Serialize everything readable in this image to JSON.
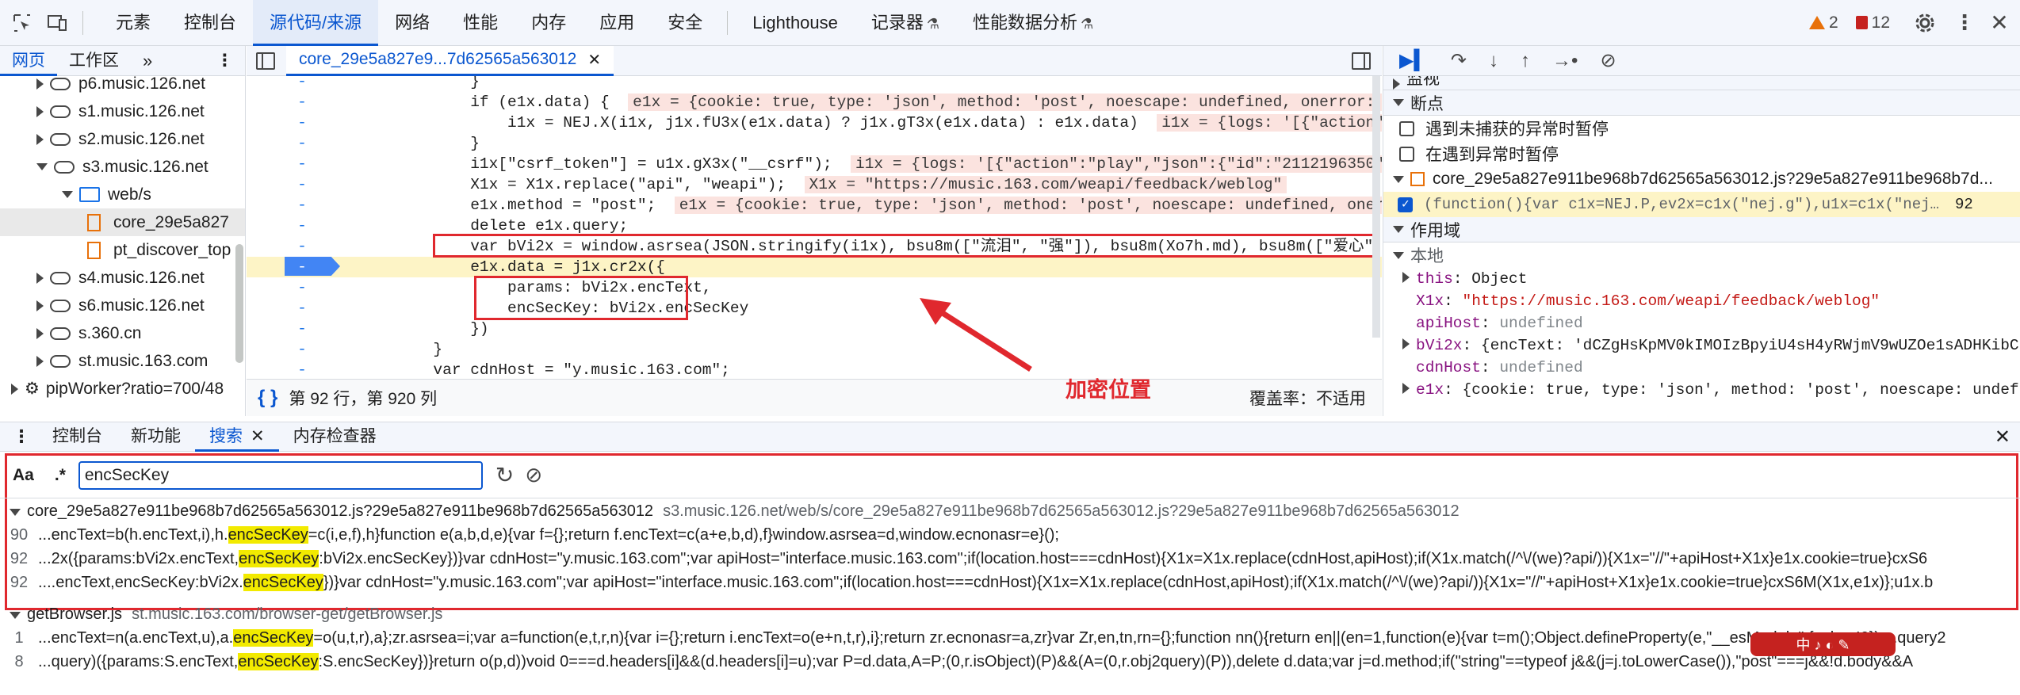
{
  "topbar": {
    "tabs": [
      "元素",
      "控制台",
      "源代码/来源",
      "网络",
      "性能",
      "内存",
      "应用",
      "安全",
      "Lighthouse",
      "记录器",
      "性能数据分析"
    ],
    "active_tab": "源代码/来源",
    "warnings": "2",
    "errors": "12"
  },
  "navigator": {
    "tabs": [
      "网页",
      "工作区"
    ],
    "items": [
      {
        "label": "p6.music.126.net",
        "depth": 1,
        "kind": "domain",
        "state": "collapsed"
      },
      {
        "label": "s1.music.126.net",
        "depth": 1,
        "kind": "domain",
        "state": "collapsed"
      },
      {
        "label": "s2.music.126.net",
        "depth": 1,
        "kind": "domain",
        "state": "collapsed"
      },
      {
        "label": "s3.music.126.net",
        "depth": 1,
        "kind": "domain",
        "state": "expanded"
      },
      {
        "label": "web/s",
        "depth": 2,
        "kind": "folder",
        "state": "expanded"
      },
      {
        "label": "core_29e5a827",
        "depth": 3,
        "kind": "file",
        "state": "selected"
      },
      {
        "label": "pt_discover_top",
        "depth": 3,
        "kind": "file",
        "state": ""
      },
      {
        "label": "s4.music.126.net",
        "depth": 1,
        "kind": "domain",
        "state": "collapsed"
      },
      {
        "label": "s6.music.126.net",
        "depth": 1,
        "kind": "domain",
        "state": "collapsed"
      },
      {
        "label": "s.360.cn",
        "depth": 1,
        "kind": "domain",
        "state": "collapsed"
      },
      {
        "label": "st.music.163.com",
        "depth": 1,
        "kind": "domain",
        "state": "collapsed"
      },
      {
        "label": "pipWorker?ratio=700/48",
        "depth": 0,
        "kind": "worker",
        "state": "collapsed"
      }
    ]
  },
  "editor": {
    "tab_label": "core_29e5a827e9...7d62565a563012",
    "lines": [
      {
        "gutter": "-",
        "code": "                }"
      },
      {
        "gutter": "-",
        "code": "                if (e1x.data) {",
        "inline": "e1x = {cookie: true, type: 'json', method: 'post', noescape: undefined, onerror: ƒ, …"
      },
      {
        "gutter": "-",
        "code": "                    i1x = NEJ.X(i1x, j1x.fU3x(e1x.data) ? j1x.gT3x(e1x.data) : e1x.data)",
        "inline": "i1x = {logs: '[{\"action\":\"pl"
      },
      {
        "gutter": "-",
        "code": "                }"
      },
      {
        "gutter": "-",
        "code": "                i1x[\"csrf_token\"] = u1x.gX3x(\"__csrf\");",
        "inline": "i1x = {logs: '[{\"action\":\"play\",\"json\":{\"id\":\"2112196350\",\"ty"
      },
      {
        "gutter": "-",
        "code": "                X1x = X1x.replace(\"api\", \"weapi\");",
        "inline": "X1x = \"https://music.163.com/weapi/feedback/weblog\""
      },
      {
        "gutter": "-",
        "code": "                e1x.method = \"post\";",
        "inline": "e1x = {cookie: true, type: 'json', method: 'post', noescape: undefined, onerror:"
      },
      {
        "gutter": "-",
        "code": "                delete e1x.query;"
      },
      {
        "gutter": "-",
        "code": "                var bVi2x = window.asrsea(JSON.stringify(i1x), bsu8m([\"流泪\", \"强\"]), bsu8m(Xo7h.md), bsu8m([\"爱心\", \"女"
      },
      {
        "gutter": "-",
        "code": "                e1x.data = j1x.cr2x({",
        "paused": true
      },
      {
        "gutter": "-",
        "code": "                    params: bVi2x.encText,"
      },
      {
        "gutter": "-",
        "code": "                    encSecKey: bVi2x.encSecKey"
      },
      {
        "gutter": "-",
        "code": "                })"
      },
      {
        "gutter": "-",
        "code": "            }"
      },
      {
        "gutter": "-",
        "code": "            var cdnHost = \"y.music.163.com\";"
      }
    ],
    "status_position": "第 92 行，第 920 列",
    "coverage": "覆盖率：不适用",
    "annotation": "加密位置"
  },
  "debugger": {
    "watch_label": "监视",
    "breakpoints_label": "断点",
    "pause_uncaught": "遇到未捕获的异常时暂停",
    "pause_caught": "在遇到异常时暂停",
    "bp_file": "core_29e5a827e911be968b7d62565a563012.js?29e5a827e911be968b7d...",
    "bp_code": "(function(){var c1x=NEJ.P,ev2x=c1x(\"nej.g\"),u1x=c1x(\"nej…",
    "bp_line": "92",
    "scope_label": "作用域",
    "local_label": "本地",
    "scope": [
      {
        "key": "this",
        "value": "Object",
        "type": "obj",
        "expandable": true
      },
      {
        "key": "X1x",
        "value": "\"https://music.163.com/weapi/feedback/weblog\"",
        "type": "str",
        "expandable": false
      },
      {
        "key": "apiHost",
        "value": "undefined",
        "type": "undef",
        "expandable": false
      },
      {
        "key": "bVi2x",
        "value": "{encText: 'dCZgHsKpMV0kIMOIzBpyiU4sH4yRWjmV9wUZOe1sADHKibC",
        "type": "obj",
        "expandable": true
      },
      {
        "key": "cdnHost",
        "value": "undefined",
        "type": "undef",
        "expandable": false
      },
      {
        "key": "e1x",
        "value": "{cookie: true, type: 'json', method: 'post', noescape: undef",
        "type": "obj",
        "expandable": true
      }
    ]
  },
  "drawer": {
    "tabs": [
      "控制台",
      "新功能",
      "搜索",
      "内存检查器"
    ],
    "active_tab": "搜索",
    "search_value": "encSecKey",
    "aa_label": "Aa",
    "regex_label": ".*",
    "results": [
      {
        "file": "core_29e5a827e911be968b7d62565a563012.js?29e5a827e911be968b7d62565a563012",
        "path": "s3.music.126.net/web/s/core_29e5a827e911be968b7d62565a563012.js?29e5a827e911be968b7d62565a563012",
        "matches": [
          {
            "line": "90",
            "pre": "...encText=b(h.encText,i),h.",
            "hit": "encSecKey",
            "post": "=c(i,e,f),h}function e(a,b,d,e){var f={};return f.encText=c(a+e,b,d),f}window.asrsea=d,window.ecnonasr=e}();"
          },
          {
            "line": "92",
            "pre": "...2x({params:bVi2x.encText,",
            "hit": "encSecKey",
            "post": ":bVi2x.encSecKey})}var cdnHost=\"y.music.163.com\";var apiHost=\"interface.music.163.com\";if(location.host===cdnHost){X1x=X1x.replace(cdnHost,apiHost);if(X1x.match(/^\\/(we)?api/)){X1x=\"//\"+apiHost+X1x}e1x.cookie=true}cxS6"
          },
          {
            "line": "92",
            "pre": "....encText,encSecKey:bVi2x.",
            "hit": "encSecKey",
            "post": "})}var cdnHost=\"y.music.163.com\";var apiHost=\"interface.music.163.com\";if(location.host===cdnHost){X1x=X1x.replace(cdnHost,apiHost);if(X1x.match(/^\\/(we)?api/)){X1x=\"//\"+apiHost+X1x}e1x.cookie=true}cxS6M(X1x,e1x)};u1x.b"
          }
        ]
      },
      {
        "file": "getBrowser.js",
        "path": "st.music.163.com/browser-get/getBrowser.js",
        "matches": [
          {
            "line": "1",
            "pre": "...encText=n(a.encText,u),a.",
            "hit": "encSecKey",
            "post": "=o(u,t,r),a};zr.asrsea=i;var a=function(e,t,r,n){var i={};return i.encText=o(e+n,t,r),i};return zr.ecnonasr=a,zr}var Zr,en,tn,rn={};function nn(){return en||(en=1,function(e){var t=m();Object.defineProperty(e,\"__esModule\",{value:!0}),e.query2"
          },
          {
            "line": "8",
            "pre": "...query)({params:S.encText,",
            "hit": "encSecKey",
            "post": ":S.encSecKey})}return o(p,d))void 0===d.headers[i]&&(d.headers[i]=u);var P=d.data,A=P;(0,r.isObject)(P)&&(A=(0,r.obj2query)(P)),delete d.data;var j=d.method;if(\"string\"==typeof j&&(j=j.toLowerCase()),\"post\"===j&&!d.body&&A"
          }
        ]
      }
    ],
    "ext_strip": "中 ♪ ◐ ✎"
  },
  "colors": {
    "accent": "#0b57d0",
    "highlight_box": "#e0282e",
    "paused_line": "#fdf4c6"
  }
}
